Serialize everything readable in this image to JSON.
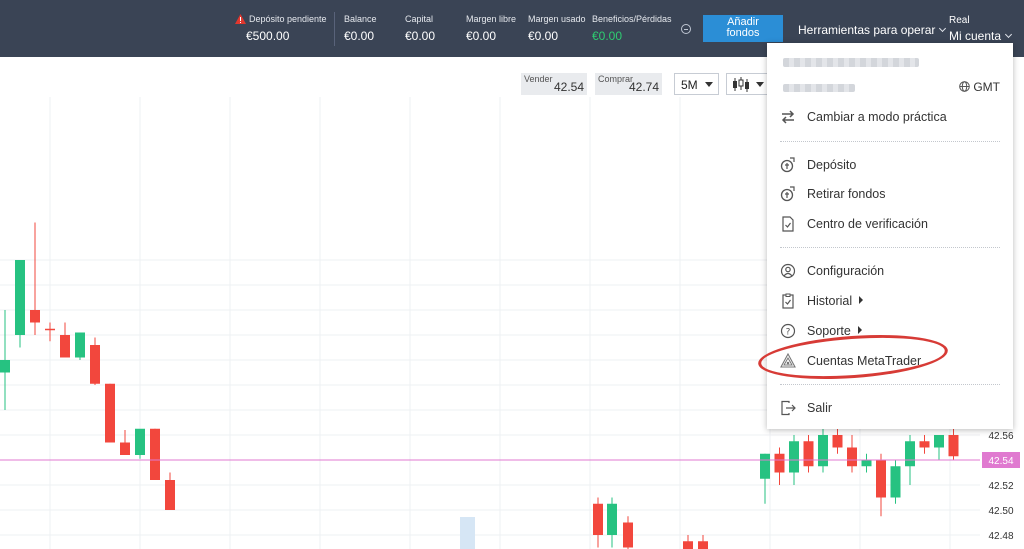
{
  "topbar": {
    "pending_label": "Depósito pendiente",
    "pending_value": "€500.00",
    "balance_label": "Balance",
    "balance_value": "€0.00",
    "capital_label": "Capital",
    "capital_value": "€0.00",
    "free_margin_label": "Margen libre",
    "free_margin_value": "€0.00",
    "used_margin_label": "Margen usado",
    "used_margin_value": "€0.00",
    "pnl_label": "Beneficios/Pérdidas",
    "pnl_value": "€0.00",
    "add_funds_line1": "Añadir",
    "add_funds_line2": "fondos",
    "tools_label": "Herramientas para operar",
    "account_type": "Real",
    "account_label": "Mi cuenta"
  },
  "toolbar": {
    "sell_label": "Vender",
    "sell_value": "42.54",
    "buy_label": "Comprar",
    "buy_value": "42.74",
    "timeframe": "5M",
    "chart_type_icon": "candlestick-icon"
  },
  "chart": {
    "current_price": "42.54",
    "y_ticks": [
      "42.56",
      "42.54",
      "42.52",
      "42.50",
      "42.48"
    ],
    "up_color": "#26c281",
    "down_color": "#f2473d",
    "price_line_color": "#e07ad0",
    "candles": [
      {
        "o": 42.61,
        "h": 42.66,
        "l": 42.58,
        "c": 42.62
      },
      {
        "o": 42.64,
        "h": 42.7,
        "l": 42.63,
        "c": 42.7
      },
      {
        "o": 42.66,
        "h": 42.73,
        "l": 42.64,
        "c": 42.65
      },
      {
        "o": 42.645,
        "h": 42.65,
        "l": 42.635,
        "c": 42.645
      },
      {
        "o": 42.64,
        "h": 42.65,
        "l": 42.622,
        "c": 42.622
      },
      {
        "o": 42.622,
        "h": 42.642,
        "l": 42.62,
        "c": 42.642
      },
      {
        "o": 42.632,
        "h": 42.638,
        "l": 42.6,
        "c": 42.601
      },
      {
        "o": 42.601,
        "h": 42.601,
        "l": 42.554,
        "c": 42.554
      },
      {
        "o": 42.554,
        "h": 42.564,
        "l": 42.544,
        "c": 42.544
      },
      {
        "o": 42.544,
        "h": 42.563,
        "l": 42.541,
        "c": 42.565
      },
      {
        "o": 42.565,
        "h": 42.565,
        "l": 42.524,
        "c": 42.524
      },
      {
        "o": 42.524,
        "h": 42.53,
        "l": 42.5,
        "c": 42.5
      }
    ]
  },
  "menu": {
    "gmt_label": "GMT",
    "items": [
      {
        "label": "Cambiar a modo práctica",
        "icon": "swap-arrows-icon"
      },
      {
        "label": "Depósito",
        "icon": "deposit-icon"
      },
      {
        "label": "Retirar fondos",
        "icon": "withdraw-icon"
      },
      {
        "label": "Centro de verificación",
        "icon": "document-check-icon"
      },
      {
        "label": "Configuración",
        "icon": "user-settings-icon"
      },
      {
        "label": "Historial",
        "icon": "clipboard-icon"
      },
      {
        "label": "Soporte",
        "icon": "help-icon"
      },
      {
        "label": "Cuentas MetaTrader",
        "icon": "metatrader-icon"
      },
      {
        "label": "Salir",
        "icon": "logout-icon"
      }
    ]
  }
}
